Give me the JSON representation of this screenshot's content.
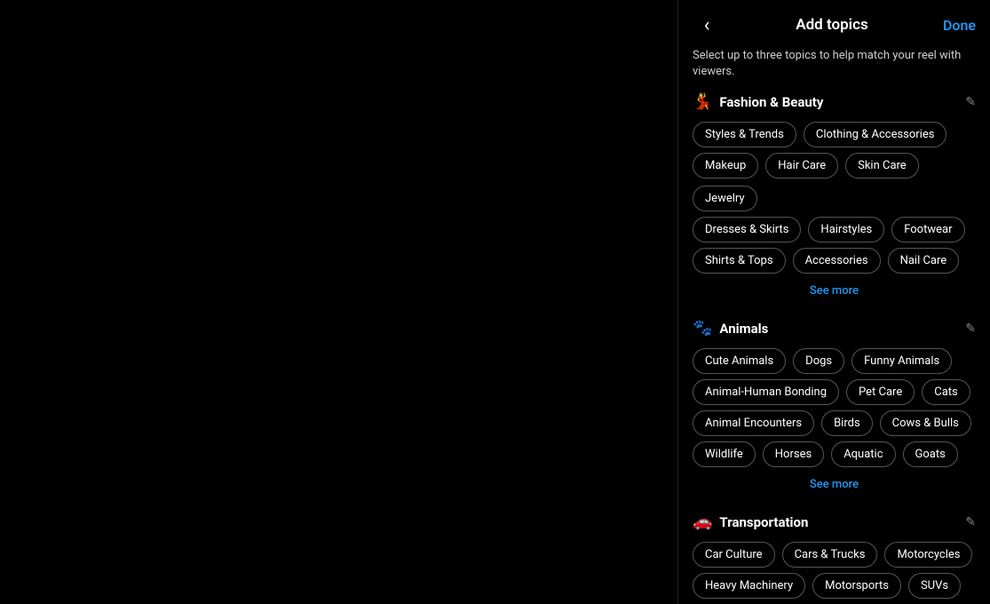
{
  "header": {
    "back_label": "‹",
    "title": "Add topics",
    "done_label": "Done"
  },
  "subtitle": "Select up to three topics to help match your reel with viewers.",
  "sections": [
    {
      "emoji": "💃",
      "title": "Fashion & Beauty",
      "tags_rows": [
        [
          "Styles & Trends",
          "Clothing & Accessories"
        ],
        [
          "Makeup",
          "Hair Care",
          "Skin Care",
          "Jewelry"
        ],
        [
          "Dresses & Skirts",
          "Hairstyles",
          "Footwear"
        ],
        [
          "Shirts & Tops",
          "Accessories",
          "Nail Care"
        ]
      ],
      "see_more": "See more"
    },
    {
      "emoji": "🐾",
      "title": "Animals",
      "tags_rows": [
        [
          "Cute Animals",
          "Dogs",
          "Funny Animals"
        ],
        [
          "Animal-Human Bonding",
          "Pet Care",
          "Cats"
        ],
        [
          "Animal Encounters",
          "Birds",
          "Cows & Bulls"
        ],
        [
          "Wildlife",
          "Horses",
          "Aquatic",
          "Goats"
        ]
      ],
      "see_more": "See more"
    },
    {
      "emoji": "🚗",
      "title": "Transportation",
      "tags_rows": [
        [
          "Car Culture",
          "Cars & Trucks",
          "Motorcycles"
        ],
        [
          "Heavy Machinery",
          "Motorsports",
          "SUVs"
        ]
      ],
      "see_more": null
    }
  ]
}
